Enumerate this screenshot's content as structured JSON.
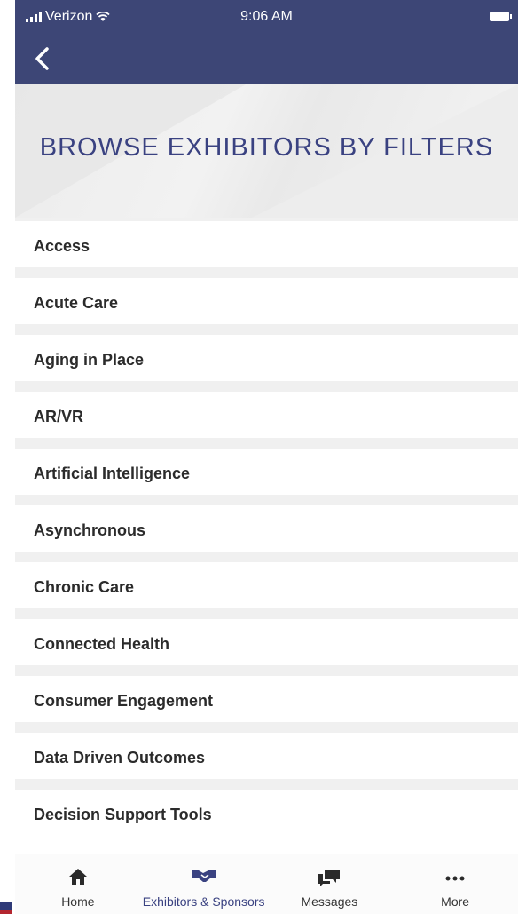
{
  "status_bar": {
    "carrier": "Verizon",
    "time": "9:06 AM"
  },
  "header": {
    "title": "BROWSE EXHIBITORS BY FILTERS"
  },
  "filters": [
    {
      "label": "Access"
    },
    {
      "label": "Acute Care"
    },
    {
      "label": "Aging in Place"
    },
    {
      "label": "AR/VR"
    },
    {
      "label": "Artificial Intelligence"
    },
    {
      "label": "Asynchronous"
    },
    {
      "label": "Chronic Care"
    },
    {
      "label": "Connected Health"
    },
    {
      "label": "Consumer Engagement"
    },
    {
      "label": "Data Driven Outcomes"
    },
    {
      "label": "Decision Support Tools"
    }
  ],
  "tabbar": {
    "tabs": [
      {
        "label": "Home",
        "icon": "home-icon"
      },
      {
        "label": "Exhibitors & Sponsors",
        "icon": "handshake-icon",
        "active": true
      },
      {
        "label": "Messages",
        "icon": "chat-bubbles-icon"
      },
      {
        "label": "More",
        "icon": "more-dots-icon"
      }
    ]
  },
  "colors": {
    "nav_background": "#3d4676",
    "title_color": "#3a4281",
    "accent": "#3a4281"
  }
}
